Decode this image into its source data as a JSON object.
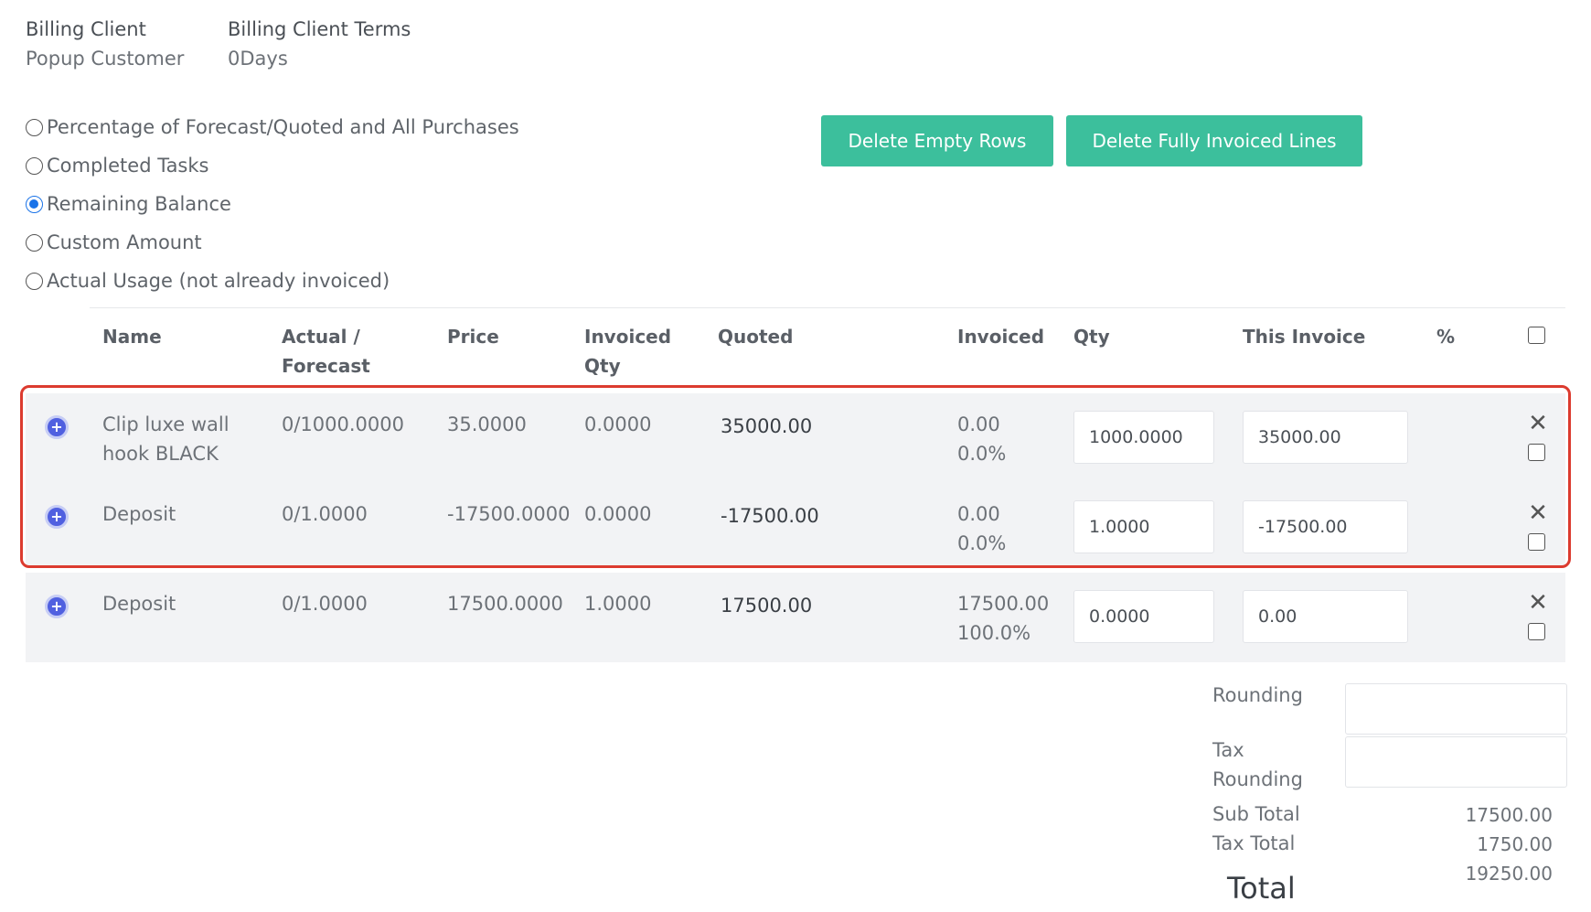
{
  "billing": {
    "client_label": "Billing Client",
    "client_value": "Popup Customer",
    "terms_label": "Billing Client Terms",
    "terms_value": "0Days"
  },
  "invoice_modes": [
    {
      "label": "Percentage of Forecast/Quoted and All Purchases",
      "checked": false
    },
    {
      "label": "Completed Tasks",
      "checked": false
    },
    {
      "label": "Remaining Balance",
      "checked": true
    },
    {
      "label": "Custom Amount",
      "checked": false
    },
    {
      "label": "Actual Usage (not already invoiced)",
      "checked": false
    }
  ],
  "buttons": {
    "delete_empty": "Delete Empty Rows",
    "delete_full": "Delete Fully Invoiced Lines"
  },
  "table": {
    "headers": {
      "name": "Name",
      "actual_1": "Actual /",
      "actual_2": "Forecast",
      "price": "Price",
      "invoiced_qty_1": "Invoiced",
      "invoiced_qty_2": "Qty",
      "quoted": "Quoted",
      "invoiced": "Invoiced",
      "qty": "Qty",
      "this_invoice": "This Invoice",
      "percent": "%"
    },
    "rows": [
      {
        "name_1": "Clip luxe wall",
        "name_2": "hook BLACK",
        "actual": "0/1000.0000",
        "price": "35.0000",
        "invoiced_qty": "0.0000",
        "quoted": "35000.00",
        "invoiced_amount": "0.00",
        "invoiced_pct": "0.0%",
        "qty": "1000.0000",
        "this_invoice": "35000.00"
      },
      {
        "name_1": "Deposit",
        "name_2": "",
        "actual": "0/1.0000",
        "price": "-17500.0000",
        "invoiced_qty": "0.0000",
        "quoted": "-17500.00",
        "invoiced_amount": "0.00",
        "invoiced_pct": "0.0%",
        "qty": "1.0000",
        "this_invoice": "-17500.00"
      },
      {
        "name_1": "Deposit",
        "name_2": "",
        "actual": "0/1.0000",
        "price": "17500.0000",
        "invoiced_qty": "1.0000",
        "quoted": "17500.00",
        "invoiced_amount": "17500.00",
        "invoiced_pct": "100.0%",
        "qty": "0.0000",
        "this_invoice": "0.00"
      }
    ]
  },
  "totals": {
    "rounding_label": "Rounding",
    "tax_rounding_label_1": "Tax",
    "tax_rounding_label_2": "Rounding",
    "subtotal_label": "Sub Total",
    "subtotal_value": "17500.00",
    "taxtotal_label": "Tax Total",
    "taxtotal_value": "1750.00",
    "total_label": "Total",
    "total_value": "19250.00"
  },
  "colors": {
    "button": "#3cbf9c",
    "highlight": "#dc3b2f",
    "plus_icon": "#5060e0",
    "radio_checked": "#1a73e8"
  }
}
